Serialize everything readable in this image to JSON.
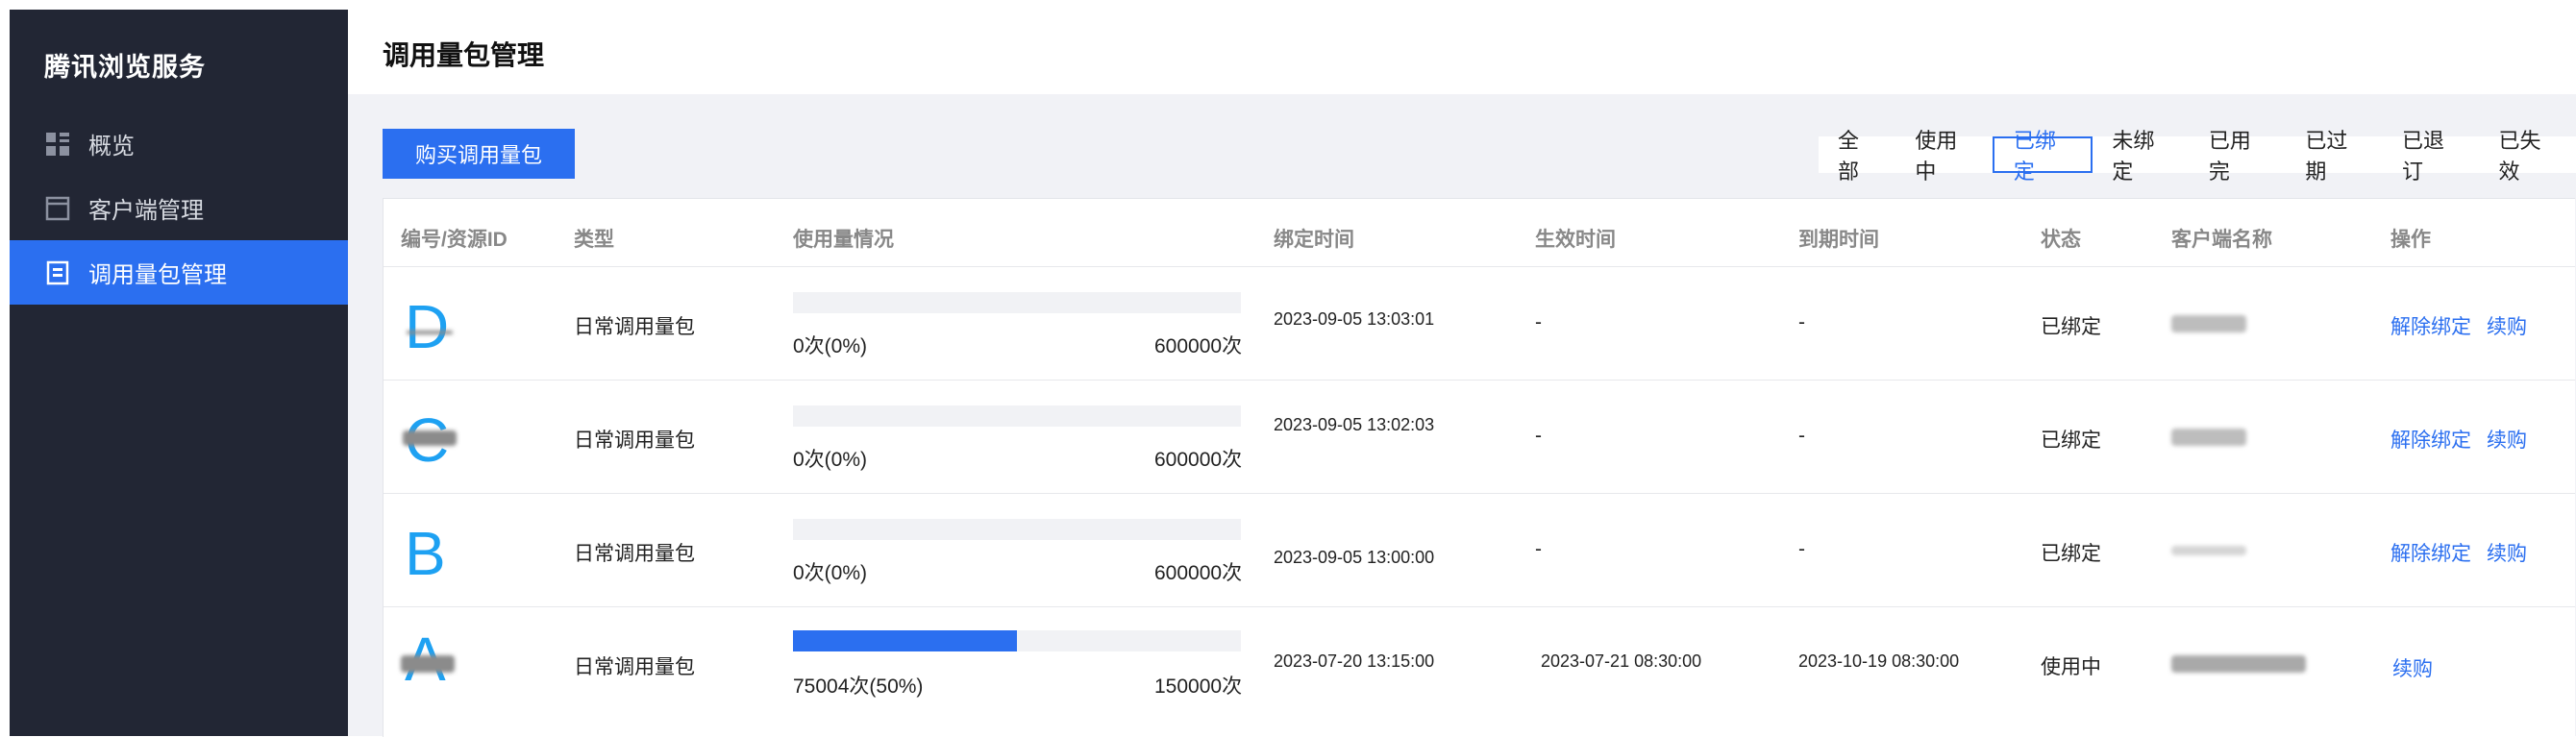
{
  "sidebar": {
    "brand": "腾讯浏览服务",
    "items": [
      {
        "label": "概览",
        "icon": "dashboard-icon"
      },
      {
        "label": "客户端管理",
        "icon": "window-icon"
      },
      {
        "label": "调用量包管理",
        "icon": "package-icon"
      }
    ],
    "active_color": "#2b6ff0"
  },
  "header": {
    "title": "调用量包管理"
  },
  "toolbar": {
    "buy_label": "购买调用量包"
  },
  "filters": [
    "全部",
    "使用中",
    "已绑定",
    "未绑定",
    "已用完",
    "已过期",
    "已退订",
    "已失效"
  ],
  "filter_active": "已绑定",
  "table": {
    "columns": [
      "编号/资源ID",
      "类型",
      "使用量情况",
      "绑定时间",
      "生效时间",
      "到期时间",
      "状态",
      "客户端名称",
      "操作"
    ],
    "rows": [
      {
        "id_letter": "D",
        "type": "日常调用量包",
        "used": "0次(0%)",
        "total": "600000次",
        "progress": 0,
        "bind_time": "2023-09-05 13:03:01",
        "effective_time": "-",
        "expire_time": "-",
        "status": "已绑定",
        "actions": [
          "解除绑定",
          "续购"
        ]
      },
      {
        "id_letter": "C",
        "type": "日常调用量包",
        "used": "0次(0%)",
        "total": "600000次",
        "progress": 0,
        "bind_time": "2023-09-05 13:02:03",
        "effective_time": "-",
        "expire_time": "-",
        "status": "已绑定",
        "actions": [
          "解除绑定",
          "续购"
        ]
      },
      {
        "id_letter": "B",
        "type": "日常调用量包",
        "used": "0次(0%)",
        "total": "600000次",
        "progress": 0,
        "bind_time": "2023-09-05 13:00:00",
        "effective_time": "-",
        "expire_time": "-",
        "status": "已绑定",
        "actions": [
          "解除绑定",
          "续购"
        ]
      },
      {
        "id_letter": "A",
        "type": "日常调用量包",
        "used": "75004次(50%)",
        "total": "150000次",
        "progress": 0.5,
        "bind_time": "2023-07-20 13:15:00",
        "effective_time": "2023-07-21 08:30:00",
        "expire_time": "2023-10-19 08:30:00",
        "status": "使用中",
        "actions": [
          "续购"
        ]
      }
    ]
  }
}
